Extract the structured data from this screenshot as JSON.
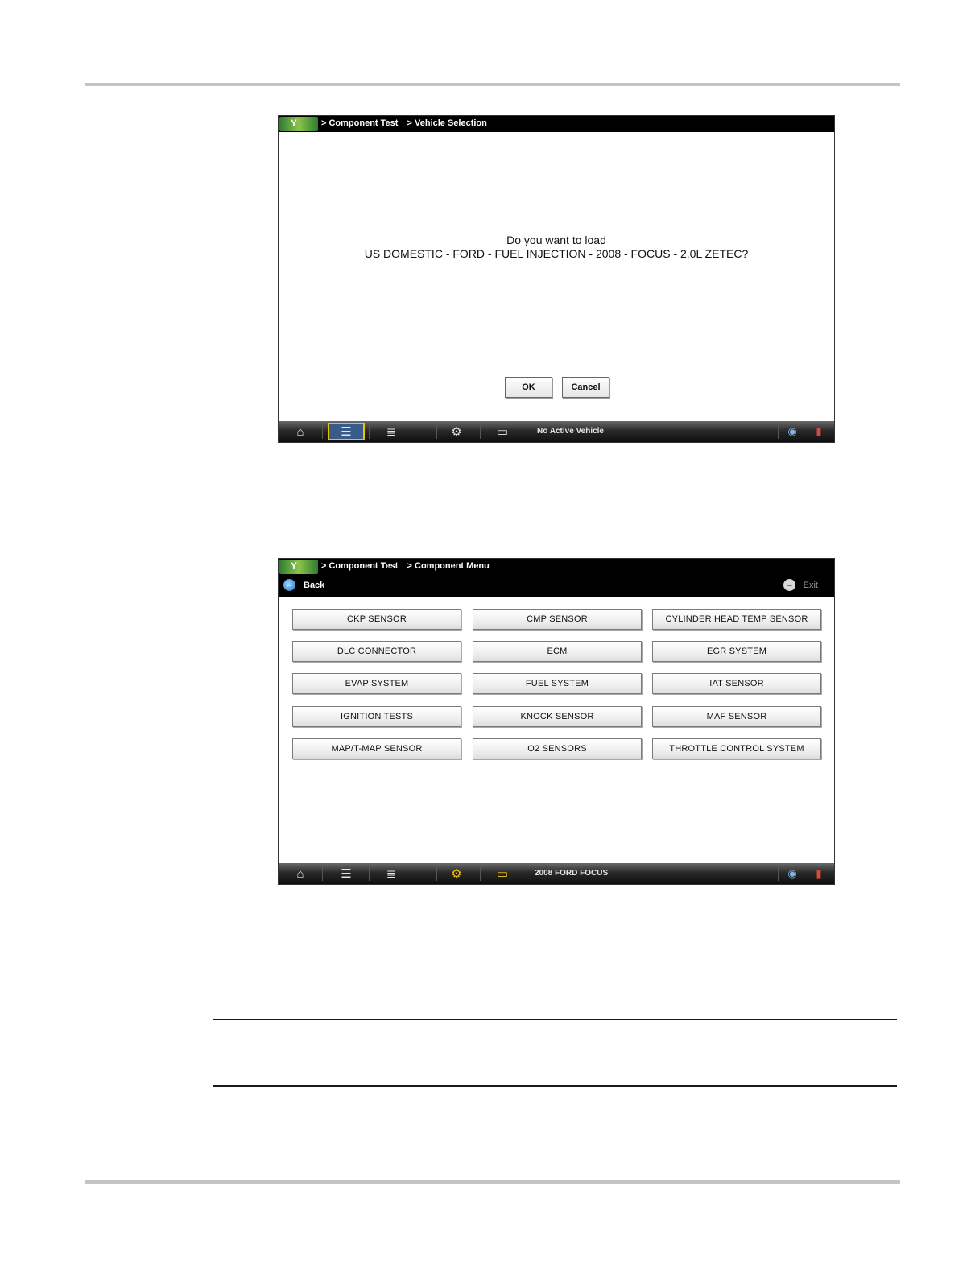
{
  "screen1": {
    "breadcrumb": [
      "> Component Test",
      "> Vehicle Selection"
    ],
    "prompt_line1": "Do you want to load",
    "prompt_line2": "US DOMESTIC - FORD - FUEL INJECTION - 2008 - FOCUS - 2.0L ZETEC?",
    "ok_label": "OK",
    "cancel_label": "Cancel",
    "status": "No Active Vehicle"
  },
  "screen2": {
    "breadcrumb": [
      "> Component Test",
      "> Component Menu"
    ],
    "back_label": "Back",
    "exit_label": "Exit",
    "menu": [
      [
        "CKP SENSOR",
        "CMP SENSOR",
        "CYLINDER HEAD TEMP SENSOR"
      ],
      [
        "DLC CONNECTOR",
        "ECM",
        "EGR SYSTEM"
      ],
      [
        "EVAP SYSTEM",
        "FUEL SYSTEM",
        "IAT SENSOR"
      ],
      [
        "IGNITION TESTS",
        "KNOCK SENSOR",
        "MAF SENSOR"
      ],
      [
        "MAP/T-MAP SENSOR",
        "O2 SENSORS",
        "THROTTLE CONTROL SYSTEM"
      ]
    ],
    "status": "2008 FORD FOCUS"
  },
  "icons": {
    "home": "⌂",
    "list": "☰",
    "tools": "≣",
    "gear": "⚙",
    "car": "▭",
    "wifi": "◉",
    "battery": "▮",
    "back": "←",
    "exit": "→",
    "logo": "Y"
  }
}
